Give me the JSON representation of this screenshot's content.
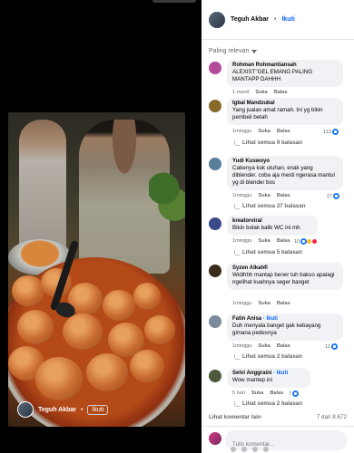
{
  "video": {
    "author_name": "Teguh Akbar",
    "separator": "•",
    "follow_label": "Ikuti"
  },
  "header": {
    "author_name": "Teguh Akbar",
    "separator": "•",
    "follow_label": "Ikuti"
  },
  "sort": {
    "label": "Paling relevan"
  },
  "comments": [
    {
      "name": "Rohman Rohmantiansah",
      "text": "ALEXIST\"GEL EMANG PALING MANTAPP DAHHH",
      "time": "1 menit",
      "like": "Suka",
      "reply": "Balas",
      "reactions": "",
      "replies": "",
      "avatar_color": "#b24c9a"
    },
    {
      "name": "Igbal Mandzubal",
      "text": "Yang jualan amat ramah. Ini yg bikin pembeli betah",
      "time": "1minggu",
      "like": "Suka",
      "reply": "Balas",
      "reactions": "113",
      "replies": "Lihat semua 9 balasan",
      "avatar_color": "#8a6a2a"
    },
    {
      "name": "Yudi Kuswoyo",
      "text": "Cabenya kok utuhan, enak yang diblender. coba aja mesti ngerasa mantul yg di blender bos",
      "time": "1minggu",
      "like": "Suka",
      "reply": "Balas",
      "reactions": "27",
      "replies": "Lihat semua 27 balasan",
      "avatar_color": "#5a7d9a"
    },
    {
      "name": "kreatorviral",
      "text": "Bikin bolak balik WC ini mh",
      "time": "1minggu",
      "like": "Suka",
      "reply": "Balas",
      "reactions": "10",
      "replies": "Lihat semua 5 balasan",
      "avatar_color": "#3a4a8a"
    },
    {
      "name": "Syzen Alkahfi",
      "text": "Widihhh mantap bener tuh bakso apalagi ngelihat kuahnya seger banget",
      "time": "1minggu",
      "like": "Suka",
      "reply": "Balas",
      "reactions": "",
      "replies": "",
      "avatar_color": "#3a2a1a"
    },
    {
      "name": "Fatin Anisa",
      "badge": "· Ikuti",
      "text": "Duh menyala banget gak kebayang gimana pedesnya",
      "time": "1minggu",
      "like": "Suka",
      "reply": "Balas",
      "reactions": "11",
      "replies": "Lihat semua 2 balasan",
      "avatar_color": "#7a8a9a"
    },
    {
      "name": "Selvi Anggraini",
      "badge": "· Ikuti",
      "text": "Wow mantep ini",
      "time": "5 hari",
      "like": "Suka",
      "reply": "Balas",
      "reactions": "7",
      "replies": "Lihat semua 2 balasan",
      "avatar_color": "#4a5a3a"
    }
  ],
  "footer": {
    "more_label": "Lihat komentar lain",
    "count": "7 dari 8.672",
    "compose_placeholder": "Tulis komentar..."
  }
}
